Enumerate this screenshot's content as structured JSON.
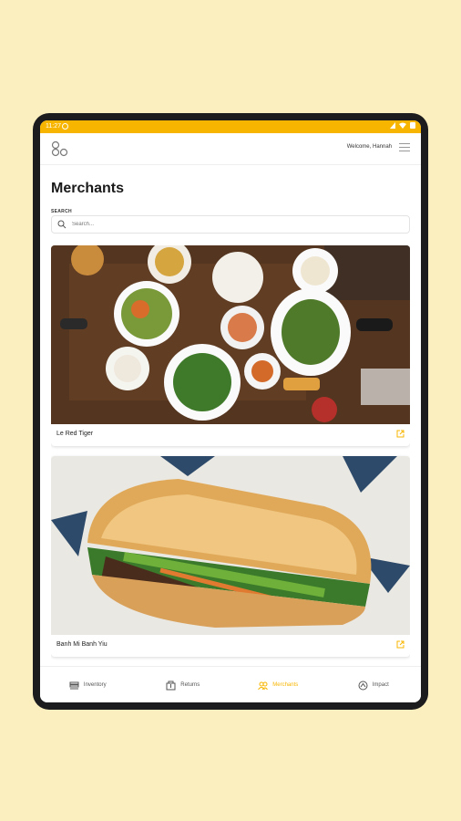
{
  "status_bar": {
    "time": "11:27"
  },
  "header": {
    "welcome": "Welcome, Hannah"
  },
  "page": {
    "title": "Merchants"
  },
  "search": {
    "label": "SEARCH",
    "placeholder": "Search..."
  },
  "merchants": [
    {
      "name": "Le Red Tiger"
    },
    {
      "name": "Banh Mi Banh Yiu"
    }
  ],
  "bottom_nav": {
    "items": [
      {
        "label": "Inventory",
        "icon": "inventory-icon"
      },
      {
        "label": "Returns",
        "icon": "returns-icon"
      },
      {
        "label": "Merchants",
        "icon": "merchants-icon"
      },
      {
        "label": "Impact",
        "icon": "impact-icon"
      }
    ],
    "active": "Merchants"
  },
  "colors": {
    "accent": "#f7b500",
    "background": "#fcefbf"
  }
}
